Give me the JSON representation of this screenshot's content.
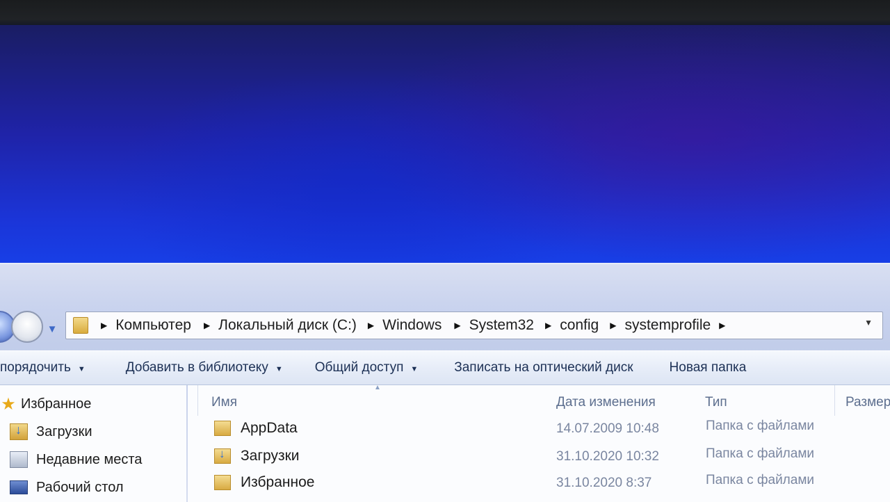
{
  "address_bar": {
    "crumbs": [
      "Компьютер",
      "Локальный диск (C:)",
      "Windows",
      "System32",
      "config",
      "systemprofile"
    ]
  },
  "toolbar": {
    "organize": "порядочить",
    "add_to_library": "Добавить в библиотеку",
    "share": "Общий доступ",
    "burn": "Записать на оптический диск",
    "new_folder": "Новая папка"
  },
  "sidebar": {
    "favorites": "Избранное",
    "items": [
      {
        "label": "Загрузки",
        "icon": "downloads-folder-icon"
      },
      {
        "label": "Недавние места",
        "icon": "recent-places-icon"
      },
      {
        "label": "Рабочий стол",
        "icon": "desktop-icon"
      }
    ]
  },
  "columns": {
    "name": "Имя",
    "date": "Дата изменения",
    "type": "Тип",
    "size": "Размер"
  },
  "files": [
    {
      "name": "AppData",
      "date": "14.07.2009 10:48",
      "type": "Папка с файлами",
      "icon": "folder-icon"
    },
    {
      "name": "Загрузки",
      "date": "31.10.2020 10:32",
      "type": "Папка с файлами",
      "icon": "downloads-folder-icon"
    },
    {
      "name": "Избранное",
      "date": "31.10.2020 8:37",
      "type": "Папка с файлами",
      "icon": "favorites-folder-icon"
    }
  ],
  "colors": {
    "desktop_blue": "#1b35d8",
    "toolbar_text": "#1c3055",
    "header_text": "#5c6e8e"
  }
}
